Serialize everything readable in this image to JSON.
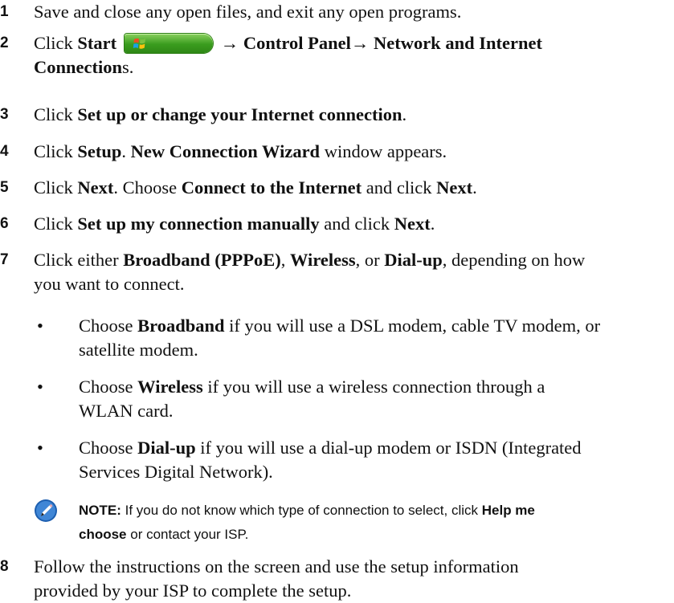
{
  "steps": [
    {
      "num": "1",
      "text": "Save and close any open files, and exit any open programs."
    },
    {
      "num": "2",
      "pre": "Click ",
      "start": "Start",
      "arrow1": " → ",
      "control_panel": "Control Panel",
      "arrow2": "→ ",
      "network1": "Network and Internet",
      "network2": "Connection",
      "network2_tail": "s."
    },
    {
      "num": "3",
      "pre": "Click ",
      "link": "Set up or change your Internet connection",
      "post": "."
    },
    {
      "num": "4",
      "pre": "Click ",
      "setup": "Setup",
      "mid": ". ",
      "wizard": "New Connection Wizard",
      "post": " window appears."
    },
    {
      "num": "5",
      "pre": "Click ",
      "next1": "Next",
      "mid": ". Choose ",
      "connect": "Connect to the Internet",
      "mid2": " and click ",
      "next2": "Next",
      "post": "."
    },
    {
      "num": "6",
      "pre": "Click ",
      "manual": "Set up my connection manually",
      "mid": " and click ",
      "next": "Next",
      "post": "."
    },
    {
      "num": "7",
      "pre": "Click either ",
      "broadband": "Broadband (PPPoE)",
      "c1": ", ",
      "wireless": "Wireless",
      "c2": ", or ",
      "dialup": "Dial-up",
      "post1": ", depending on how",
      "line2": "you want to connect."
    },
    {
      "num": "8",
      "line1": "Follow the instructions on the screen and use the setup information",
      "line2": "provided by your ISP to complete the setup."
    }
  ],
  "bullets": [
    {
      "pre": "Choose ",
      "bold": "Broadband",
      "post1": " if you will use a DSL modem, cable TV modem, or",
      "line2": "satellite modem."
    },
    {
      "pre": "Choose ",
      "bold": "Wireless",
      "post1": " if you will use a wireless connection through a",
      "line2": "WLAN card."
    },
    {
      "pre": "Choose ",
      "bold": "Dial-up",
      "post1": " if you will use a dial-up modem or ISDN (Integrated",
      "line2": "Services Digital Network)."
    }
  ],
  "bullet_glyph": "•",
  "note": {
    "label": "NOTE:",
    "text1": " If you do not know which type of connection to select, click ",
    "help1": "Help me",
    "help2": "choose",
    "text2": " or contact your ISP."
  },
  "icons": {
    "start_button": "start-button-icon",
    "note": "pencil-note-icon"
  }
}
